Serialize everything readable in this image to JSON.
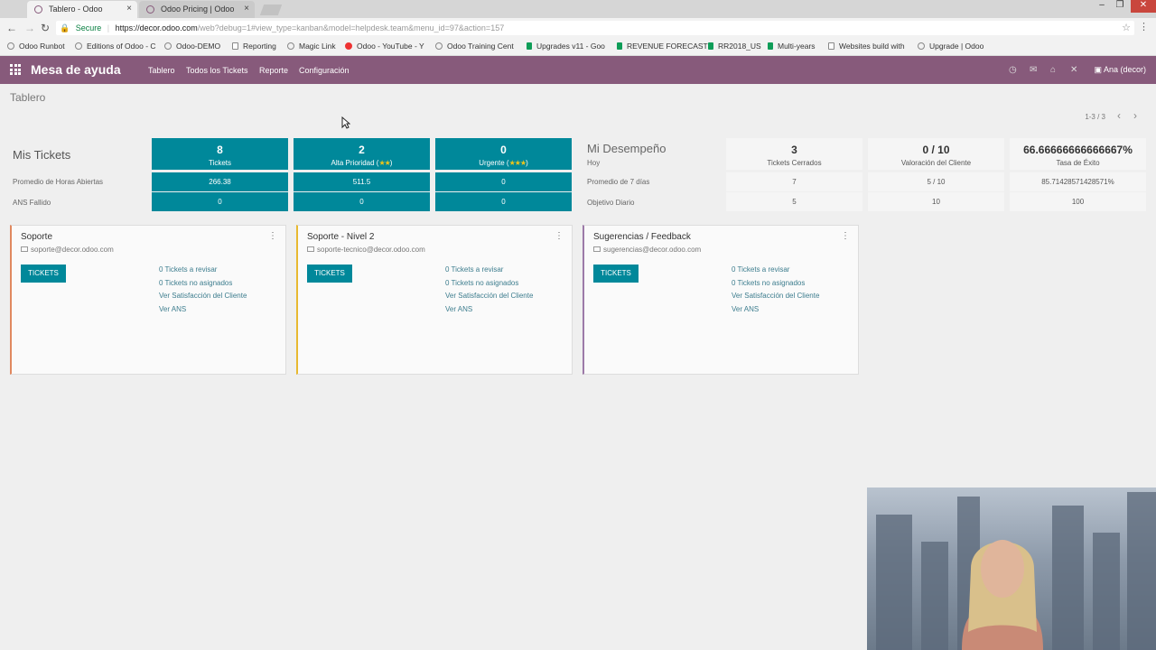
{
  "browser": {
    "tabs": [
      {
        "title": "Tablero - Odoo",
        "close": "×"
      },
      {
        "title": "Odoo Pricing | Odoo",
        "close": "×"
      }
    ],
    "url": {
      "secure": "Secure",
      "host": "https://decor.odoo.com",
      "path": "/web?debug=1#view_type=kanban&model=helpdesk.team&menu_id=97&action=157"
    },
    "bookmarks": [
      "Odoo Runbot",
      "Editions of Odoo - C",
      "Odoo-DEMO",
      "Reporting",
      "Magic Link",
      "Odoo - YouTube - Y",
      "Odoo Training Cent",
      "Upgrades v11 - Goo",
      "REVENUE FORECAST",
      "RR2018_US",
      "Multi-years",
      "Websites build with",
      "Upgrade | Odoo"
    ]
  },
  "odoo_nav": {
    "brand": "Mesa de ayuda",
    "menu": [
      "Tablero",
      "Todos los Tickets",
      "Reporte",
      "Configuración"
    ],
    "user": "Ana (decor)"
  },
  "control_panel": {
    "breadcrumb": "Tablero",
    "pager": "1-3 / 3"
  },
  "dashboard": {
    "mis_tickets": {
      "title": "Mis Tickets",
      "row_labels": [
        "Promedio de Horas Abiertas",
        "ANS Fallido"
      ],
      "tiles": [
        {
          "num": "8",
          "cap": "Tickets",
          "stars": "",
          "avg": "266.38",
          "sla": "0"
        },
        {
          "num": "2",
          "cap": "Alta Prioridad (",
          "stars": "★★",
          "cap_end": ")",
          "avg": "511.5",
          "sla": "0"
        },
        {
          "num": "0",
          "cap": "Urgente (",
          "stars": "★★★",
          "cap_end": ")",
          "avg": "0",
          "sla": "0"
        }
      ]
    },
    "performance": {
      "title": "Mi Desempeño",
      "row_labels": [
        "Hoy",
        "Promedio de 7 días",
        "Objetivo Diario"
      ],
      "cells": [
        {
          "num": "3",
          "cap": "Tickets Cerrados",
          "avg": "7",
          "goal": "5"
        },
        {
          "num": "0 / 10",
          "cap": "Valoración del Cliente",
          "avg": "5 / 10",
          "goal": "10"
        },
        {
          "num": "66.66666666666667%",
          "cap": "Tasa de Éxito",
          "avg": "85.71428571428571%",
          "goal": "100"
        }
      ]
    }
  },
  "teams": [
    {
      "name": "Soporte",
      "email": "soporte@decor.odoo.com",
      "color": "#e0885f",
      "button": "TICKETS",
      "links": [
        "0 Tickets a revisar",
        "0 Tickets no asignados",
        "Ver Satisfacción del Cliente",
        "Ver ANS"
      ]
    },
    {
      "name": "Soporte - Nivel 2",
      "email": "soporte-tecnico@decor.odoo.com",
      "color": "#e8b930",
      "button": "TICKETS",
      "links": [
        "0 Tickets a revisar",
        "0 Tickets no asignados",
        "Ver Satisfacción del Cliente",
        "Ver ANS"
      ]
    },
    {
      "name": "Sugerencias / Feedback",
      "email": "sugerencias@decor.odoo.com",
      "color": "#9c7aa8",
      "button": "TICKETS",
      "links": [
        "0 Tickets a revisar",
        "0 Tickets no asignados",
        "Ver Satisfacción del Cliente",
        "Ver ANS"
      ]
    }
  ],
  "colors": {
    "brand": "#875a7b",
    "tile": "#00889a",
    "link": "#3d7d8e"
  }
}
